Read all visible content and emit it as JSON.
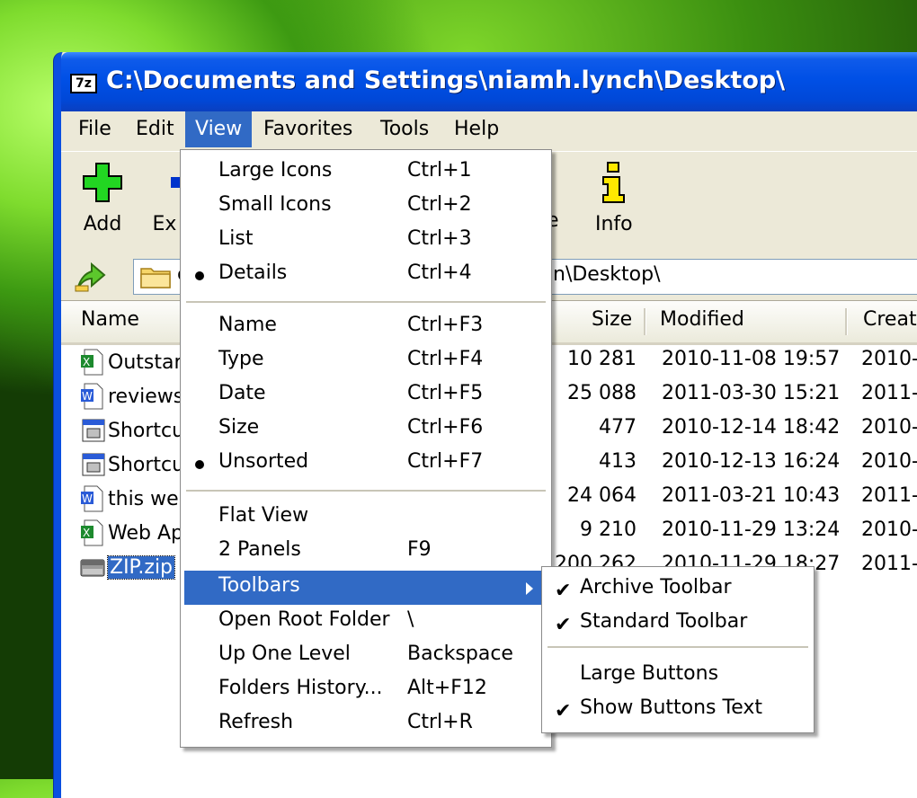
{
  "window": {
    "title": "C:\\Documents and Settings\\niamh.lynch\\Desktop\\",
    "app_icon_label": "7z"
  },
  "menubar": [
    "File",
    "Edit",
    "View",
    "Favorites",
    "Tools",
    "Help"
  ],
  "toolbar": {
    "add_label": "Add",
    "extract_label": "Ex",
    "info_label": "Info",
    "partial_label": "e"
  },
  "address": {
    "value_visible": "n\\Desktop\\",
    "left_fragment": "c"
  },
  "columns": {
    "name": "Name",
    "size": "Size",
    "modified": "Modified",
    "created": "Creat"
  },
  "files": [
    {
      "name": "Outstar",
      "icon": "excel-file-icon",
      "size": "10 281",
      "modified": "2010-11-08 19:57",
      "created": "2010-"
    },
    {
      "name": "reviews",
      "icon": "word-file-icon",
      "size": "25 088",
      "modified": "2011-03-30 15:21",
      "created": "2011-0"
    },
    {
      "name": "Shortcu",
      "icon": "shortcut-file-icon",
      "size": "477",
      "modified": "2010-12-14 18:42",
      "created": "2010-"
    },
    {
      "name": "Shortcu",
      "icon": "shortcut-file-icon",
      "size": "413",
      "modified": "2010-12-13 16:24",
      "created": "2010-"
    },
    {
      "name": "this we",
      "icon": "word-file-icon",
      "size": "24 064",
      "modified": "2011-03-21 10:43",
      "created": "2011-0"
    },
    {
      "name": "Web Ap",
      "icon": "excel-file-icon",
      "size": "9 210",
      "modified": "2010-11-29 13:24",
      "created": "2010-"
    },
    {
      "name": "ZIP.zip",
      "icon": "zip-archive-icon",
      "size": "200 262",
      "modified": "2010-11-29 18:27",
      "created": "2011-0"
    }
  ],
  "view_menu": {
    "group1": [
      {
        "label": "Large Icons",
        "shortcut": "Ctrl+1"
      },
      {
        "label": "Small Icons",
        "shortcut": "Ctrl+2"
      },
      {
        "label": "List",
        "shortcut": "Ctrl+3"
      },
      {
        "label": "Details",
        "shortcut": "Ctrl+4"
      }
    ],
    "group2": [
      {
        "label": "Name",
        "shortcut": "Ctrl+F3"
      },
      {
        "label": "Type",
        "shortcut": "Ctrl+F4"
      },
      {
        "label": "Date",
        "shortcut": "Ctrl+F5"
      },
      {
        "label": "Size",
        "shortcut": "Ctrl+F6"
      },
      {
        "label": "Unsorted",
        "shortcut": "Ctrl+F7"
      }
    ],
    "group3": [
      {
        "label": "Flat View",
        "shortcut": ""
      },
      {
        "label": "2 Panels",
        "shortcut": "F9"
      },
      {
        "label": "Toolbars",
        "shortcut": ""
      },
      {
        "label": "Open Root Folder",
        "shortcut": "\\"
      },
      {
        "label": "Up One Level",
        "shortcut": "Backspace"
      },
      {
        "label": "Folders History...",
        "shortcut": "Alt+F12"
      },
      {
        "label": "Refresh",
        "shortcut": "Ctrl+R"
      }
    ]
  },
  "toolbars_submenu": [
    {
      "label": "Archive Toolbar"
    },
    {
      "label": "Standard Toolbar"
    },
    {
      "label": "Large Buttons"
    },
    {
      "label": "Show Buttons Text"
    }
  ]
}
